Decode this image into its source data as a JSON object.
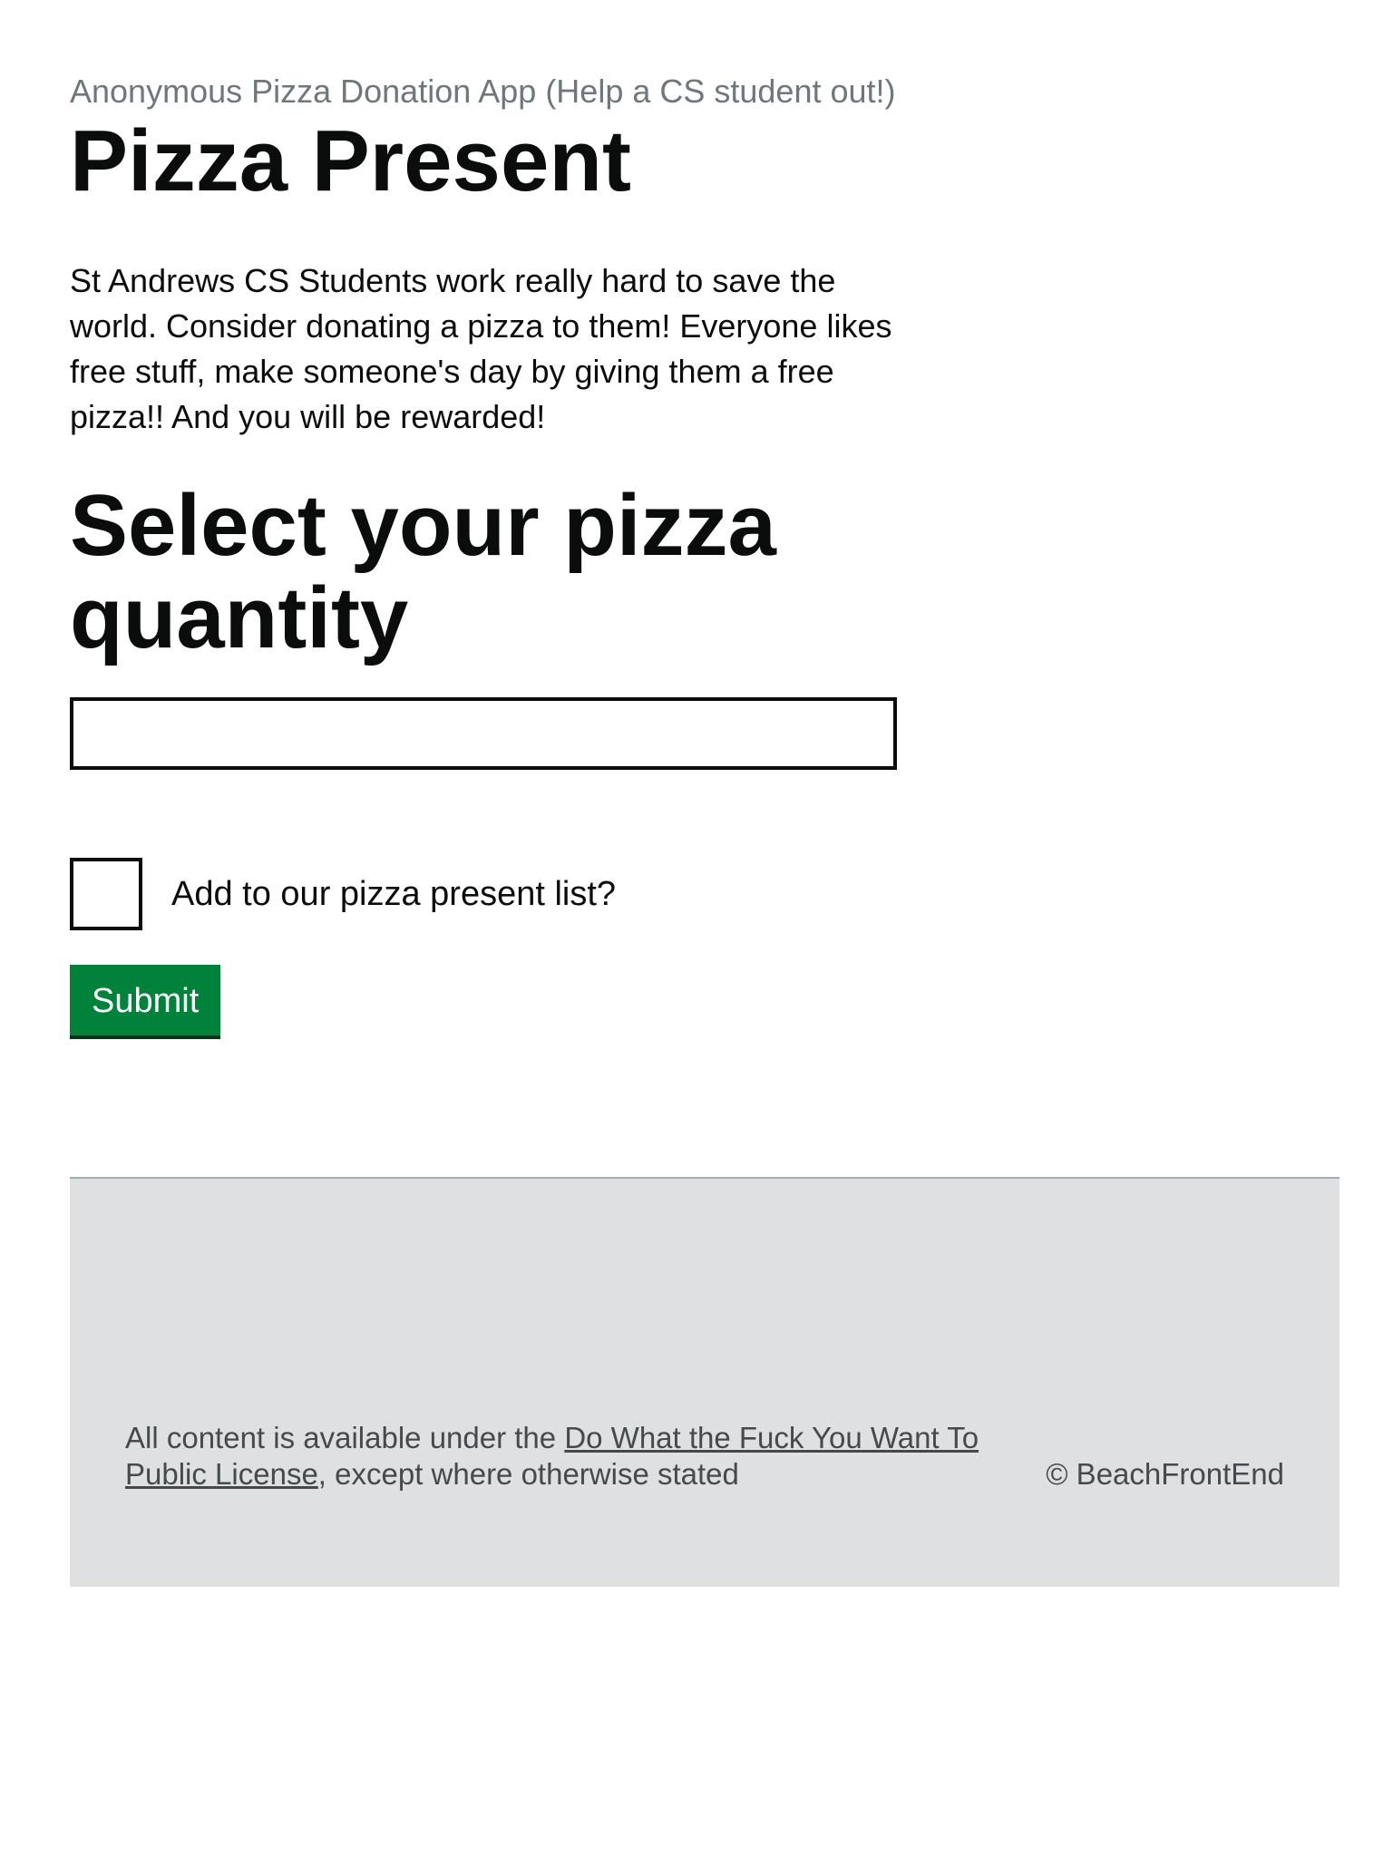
{
  "header": {
    "caption": "Anonymous Pizza Donation App (Help a CS student out!)",
    "title": "Pizza Present"
  },
  "intro": {
    "text": "St Andrews CS Students work really hard to save the world. Consider donating a pizza to them! Everyone likes free stuff, make someone's day by giving them a free pizza!! And you will be rewarded!"
  },
  "form": {
    "heading": "Select your pizza quantity",
    "quantity": {
      "value": "",
      "placeholder": ""
    },
    "checkbox": {
      "label": "Add to our pizza present list?",
      "checked": false
    },
    "submit_label": "Submit"
  },
  "footer": {
    "license_prefix": "All content is available under the ",
    "license_link": "Do What the Fuck You Want To Public License",
    "license_suffix": ", except where otherwise stated",
    "copyright": "© BeachFrontEnd"
  },
  "colors": {
    "button": "#00823b",
    "button_shadow": "#003618",
    "footer_bg": "#dee0e2",
    "caption": "#6f777b",
    "text": "#0b0c0c"
  }
}
